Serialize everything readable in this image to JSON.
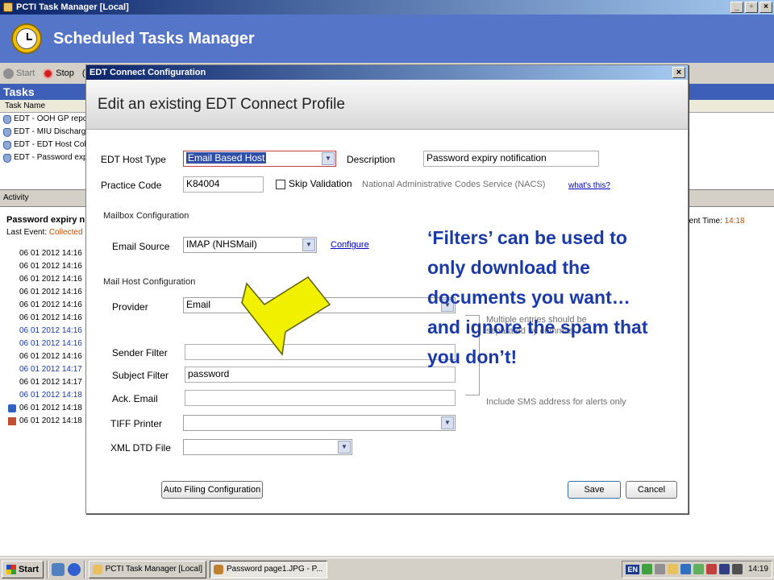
{
  "window": {
    "title": "PCTI Task Manager [Local]",
    "min": "_",
    "max": "▫",
    "close": "×"
  },
  "banner": {
    "title": "Scheduled Tasks Manager"
  },
  "toolbar": {
    "start": "Start",
    "stop": "Stop",
    "more": "("
  },
  "tasks": {
    "header": "Tasks",
    "column": "Task Name",
    "rows": [
      "EDT - OOH GP repc",
      "EDT - MIU Discharg",
      "EDT - EDT Host Col",
      "EDT - Password exp"
    ]
  },
  "activity": {
    "header": "Activity",
    "title": "Password expiry n",
    "last_event_label": "Last Event:",
    "last_event_value": "Collected",
    "current_time_label": "rrent Time:",
    "current_time_value": "14:18",
    "log": [
      {
        "t": "06 01 2012 14:16",
        "blue": false
      },
      {
        "t": "06 01 2012 14:16",
        "blue": false
      },
      {
        "t": "06 01 2012 14:16",
        "blue": false
      },
      {
        "t": "06 01 2012 14:16",
        "blue": false
      },
      {
        "t": "06 01 2012 14:16",
        "blue": false
      },
      {
        "t": "06 01 2012 14:16",
        "blue": false
      },
      {
        "t": "06 01 2012 14:16",
        "blue": true
      },
      {
        "t": "06 01 2012 14:16",
        "blue": true
      },
      {
        "t": "06 01 2012 14:16",
        "blue": false
      },
      {
        "t": "06 01 2012 14:17",
        "blue": true
      },
      {
        "t": "06 01 2012 14:17",
        "blue": false
      },
      {
        "t": "06 01 2012 14:18",
        "blue": true
      },
      {
        "t": "06 01 2012 14:18",
        "blue": false
      },
      {
        "t": "06 01 2012 14:18",
        "blue": false
      }
    ]
  },
  "dialog": {
    "title": "EDT Connect Configuration",
    "close": "×",
    "heading": "Edit an existing EDT Connect Profile",
    "host_type_label": "EDT Host Type",
    "host_type_value": "Email Based Host",
    "description_label": "Description",
    "description_value": "Password expiry notification",
    "practice_code_label": "Practice Code",
    "practice_code_value": "K84004",
    "skip_validation_label": "Skip Validation",
    "nacs_text": "National Administrative Codes Service (NACS)",
    "whats_this": "what's this?",
    "mailbox_section": "Mailbox Configuration",
    "email_source_label": "Email Source",
    "email_source_value": "IMAP (NHSMail)",
    "configure_link": "Configure",
    "mailhost_section": "Mail Host Configuration",
    "provider_label": "Provider",
    "provider_value": "Email",
    "multiple_entries_note": "Multiple entries should be",
    "multiple_entries_note2": "separated by commas",
    "sender_filter_label": "Sender Filter",
    "sender_filter_value": "",
    "subject_filter_label": "Subject Filter",
    "subject_filter_value": "password",
    "ack_email_label": "Ack. Email",
    "ack_email_value": "",
    "sms_note": "Include SMS address for alerts only",
    "tiff_printer_label": "TIFF Printer",
    "tiff_printer_value": "",
    "xml_dtd_label": "XML DTD File",
    "xml_dtd_value": "",
    "auto_filing_button": "Auto Filing Configuration",
    "save_button": "Save",
    "cancel_button": "Cancel"
  },
  "callout": {
    "text": "‘Filters’ can be used to only download the documents you want… and ignore the spam that you don’t!",
    "arrow_color": "#f0f000"
  },
  "taskbar": {
    "start": "Start",
    "tasks": [
      "PCTI Task Manager [Local]",
      "Password page1.JPG - P..."
    ],
    "lang": "EN",
    "clock": "14:19"
  }
}
